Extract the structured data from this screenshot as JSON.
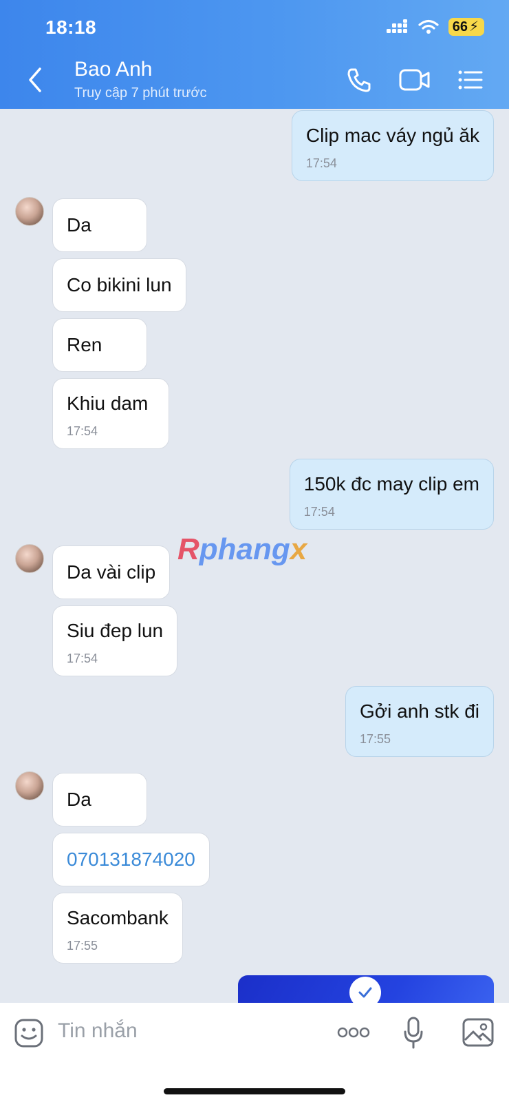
{
  "status": {
    "time": "18:18",
    "battery": "66"
  },
  "header": {
    "name": "Bao Anh",
    "subtitle": "Truy cập 7 phút trước"
  },
  "messages": [
    {
      "dir": "out",
      "text": "Clip mac váy ngủ ăk",
      "time": "17:54"
    },
    {
      "dir": "in",
      "text": "Da"
    },
    {
      "dir": "in",
      "text": "Co bikini lun"
    },
    {
      "dir": "in",
      "text": "Ren"
    },
    {
      "dir": "in",
      "text": "Khiu dam",
      "time": "17:54"
    },
    {
      "dir": "out",
      "text": "150k đc may clip em",
      "time": "17:54"
    },
    {
      "dir": "in",
      "text": "Da vài clip"
    },
    {
      "dir": "in",
      "text": "Siu đep lun",
      "time": "17:54"
    },
    {
      "dir": "out",
      "text": "Gởi anh stk đi",
      "time": "17:55"
    },
    {
      "dir": "in",
      "text": "Da"
    },
    {
      "dir": "in",
      "text": "070131874020",
      "link": true
    },
    {
      "dir": "in",
      "text": "Sacombank",
      "time": "17:55"
    }
  ],
  "watermark": {
    "r": "R",
    "mid": "phang",
    "x": "x"
  },
  "composer": {
    "placeholder": "Tin nhắn"
  },
  "icons": {
    "back": "chevron-left-icon",
    "call": "phone-icon",
    "video": "video-camera-icon",
    "menu": "list-menu-icon",
    "sticker": "sticker-smile-icon",
    "more": "more-dots-icon",
    "mic": "microphone-icon",
    "gallery": "image-gallery-icon",
    "check": "check-icon"
  },
  "colors": {
    "header": "#4d97f0",
    "outgoing_bubble": "#d5ebfb",
    "incoming_bubble": "#ffffff",
    "link": "#3a8ad8",
    "background": "#e3e8f0"
  }
}
